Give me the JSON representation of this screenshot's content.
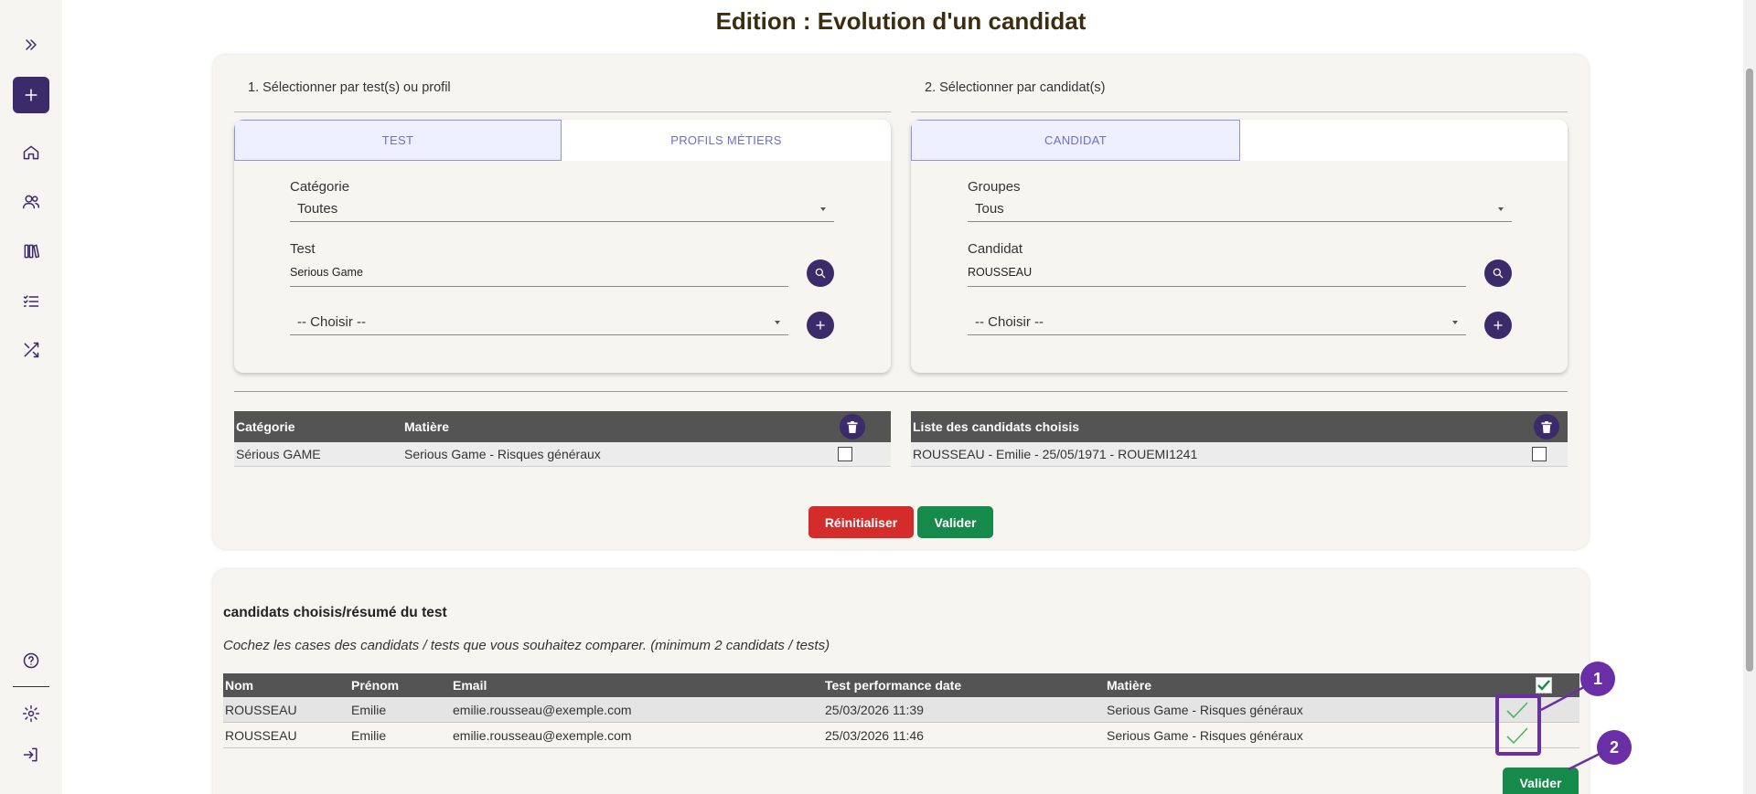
{
  "page": {
    "title": "Edition : Evolution d'un candidat"
  },
  "sidebar": {
    "icons": [
      "expand-icon",
      "add-icon",
      "home-icon",
      "users-icon",
      "library-icon",
      "checklist-icon",
      "shuffle-icon",
      "help-icon",
      "settings-icon",
      "logout-icon"
    ]
  },
  "left_section": {
    "heading": "1. Sélectionner par test(s) ou profil",
    "tabs": [
      "TEST",
      "PROFILS MÉTIERS"
    ],
    "categorie_label": "Catégorie",
    "categorie_value": "Toutes",
    "test_label": "Test",
    "test_value": "Serious Game",
    "choose_placeholder": "-- Choisir --",
    "table": {
      "headers": [
        "Catégorie",
        "Matière"
      ],
      "rows": [
        {
          "categorie": "Sérious GAME",
          "matiere": "Serious Game - Risques généraux"
        }
      ]
    }
  },
  "right_section": {
    "heading": "2. Sélectionner par candidat(s)",
    "tabs": [
      "CANDIDAT"
    ],
    "groupes_label": "Groupes",
    "groupes_value": "Tous",
    "candidat_label": "Candidat",
    "candidat_value": "ROUSSEAU",
    "choose_placeholder": "-- Choisir --",
    "table": {
      "header": "Liste des candidats choisis",
      "rows": [
        {
          "text": "ROUSSEAU - Emilie - 25/05/1971 - ROUEMI1241"
        }
      ]
    }
  },
  "actions": {
    "reset": "Réinitialiser",
    "validate": "Valider"
  },
  "summary": {
    "title": "candidats choisis/résumé du test",
    "subtitle": "Cochez les cases des candidats / tests que vous souhaitez comparer. (minimum 2 candidats / tests)",
    "columns": [
      "Nom",
      "Prénom",
      "Email",
      "Test performance date",
      "Matière"
    ],
    "rows": [
      {
        "nom": "ROUSSEAU",
        "prenom": "Emilie",
        "email": "emilie.rousseau@exemple.com",
        "date": "25/03/2026 11:39",
        "matiere": "Serious Game - Risques généraux",
        "checked": true
      },
      {
        "nom": "ROUSSEAU",
        "prenom": "Emilie",
        "email": "emilie.rousseau@exemple.com",
        "date": "25/03/2026 11:46",
        "matiere": "Serious Game - Risques généraux",
        "checked": true
      }
    ],
    "validate": "Valider"
  },
  "annotations": [
    "1",
    "2"
  ],
  "colors": {
    "primary": "#3a2b6a",
    "danger": "#d42b2b",
    "success": "#158a4a",
    "annotation": "#6a2fa6"
  }
}
